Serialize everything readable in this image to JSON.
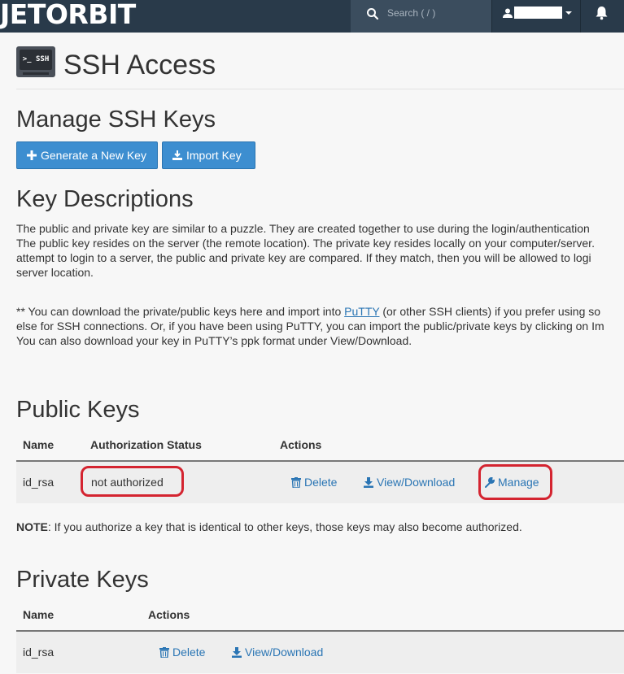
{
  "topbar": {
    "logo": "JETORBIT",
    "search_placeholder": "Search ( / )"
  },
  "page": {
    "icon_label": ">_ SSH",
    "title": "SSH Access"
  },
  "manage_keys": {
    "heading": "Manage SSH Keys",
    "generate_button": "Generate a New Key",
    "import_button": "Import Key"
  },
  "key_descriptions": {
    "heading": "Key Descriptions",
    "lines1": [
      "The public and private key are similar to a puzzle. They are created together to use during the login/authentication",
      "The public key resides on the server (the remote location). The private key resides locally on your computer/server.",
      "attempt to login to a server, the public and private key are compared. If they match, then you will be allowed to logi",
      "server location."
    ],
    "line2a_pre": "** You can download the private/public keys here and import into ",
    "line2a_link": "PuTTY",
    "line2a_post": " (or other SSH clients) if you prefer using so",
    "line2b": "else for SSH connections. Or, if you have been using PuTTY, you can import the public/private keys by clicking on Im",
    "line2c": "You can also download your key in PuTTY’s ppk format under View/Download."
  },
  "public_keys": {
    "heading": "Public Keys",
    "col_name": "Name",
    "col_status": "Authorization Status",
    "col_actions": "Actions",
    "row": {
      "name": "id_rsa",
      "status": "not authorized",
      "delete": "Delete",
      "view_download": "View/Download",
      "manage": "Manage"
    }
  },
  "note": {
    "label": "NOTE",
    "text": ": If you authorize a key that is identical to other keys, those keys may also become authorized."
  },
  "private_keys": {
    "heading": "Private Keys",
    "col_name": "Name",
    "col_actions": "Actions",
    "row": {
      "name": "id_rsa",
      "delete": "Delete",
      "view_download": "View/Download"
    }
  },
  "colors": {
    "topbar": "#293a4a",
    "button": "#3d8ed0",
    "link": "#2a75b4",
    "highlight_circle": "#d42430"
  }
}
